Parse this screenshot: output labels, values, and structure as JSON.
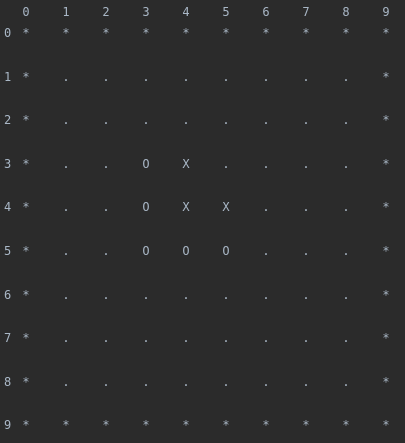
{
  "header": {
    "columns": [
      "0",
      "1",
      "2",
      "3",
      "4",
      "5",
      "6",
      "7",
      "8",
      "9"
    ]
  },
  "board": {
    "rows": [
      {
        "label": "0",
        "cells": [
          "*",
          "*",
          "*",
          "*",
          "*",
          "*",
          "*",
          "*",
          "*",
          "*"
        ]
      },
      {
        "label": "1",
        "cells": [
          "*",
          ".",
          ".",
          ".",
          ".",
          ".",
          ".",
          ".",
          ".",
          "*"
        ]
      },
      {
        "label": "2",
        "cells": [
          "*",
          ".",
          ".",
          ".",
          ".",
          ".",
          ".",
          ".",
          ".",
          "*"
        ]
      },
      {
        "label": "3",
        "cells": [
          "*",
          ".",
          ".",
          "O",
          "X",
          ".",
          ".",
          ".",
          ".",
          "*"
        ]
      },
      {
        "label": "4",
        "cells": [
          "*",
          ".",
          ".",
          "O",
          "X",
          "X",
          ".",
          ".",
          ".",
          "*"
        ]
      },
      {
        "label": "5",
        "cells": [
          "*",
          ".",
          ".",
          "O",
          "O",
          "O",
          ".",
          ".",
          ".",
          "*"
        ]
      },
      {
        "label": "6",
        "cells": [
          "*",
          ".",
          ".",
          ".",
          ".",
          ".",
          ".",
          ".",
          ".",
          "*"
        ]
      },
      {
        "label": "7",
        "cells": [
          "*",
          ".",
          ".",
          ".",
          ".",
          ".",
          ".",
          ".",
          ".",
          "*"
        ]
      },
      {
        "label": "8",
        "cells": [
          "*",
          ".",
          ".",
          ".",
          ".",
          ".",
          ".",
          ".",
          ".",
          "*"
        ]
      },
      {
        "label": "9",
        "cells": [
          "*",
          "*",
          "*",
          "*",
          "*",
          "*",
          "*",
          "*",
          "*",
          "*"
        ]
      }
    ]
  }
}
